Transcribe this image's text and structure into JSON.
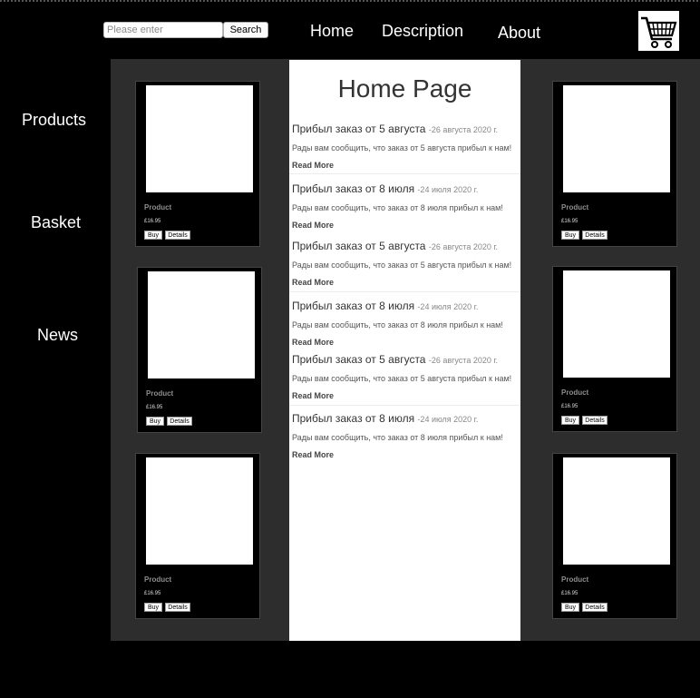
{
  "search": {
    "placeholder": "Please enter",
    "value": "",
    "button_label": "Search"
  },
  "nav": {
    "home": "Home",
    "description": "Description",
    "about": "About"
  },
  "sidebar": {
    "products": "Products",
    "basket": "Basket",
    "news": "News"
  },
  "main": {
    "title": "Home Page",
    "news": [
      {
        "heading": "Прибыл заказ от 5 августа",
        "date": "-26 августа 2020 г.",
        "text": "Рады вам сообщить, что заказ от 5 августа прибыл к нам!",
        "more": "Read More"
      },
      {
        "heading": "Прибыл заказ от 8 июля",
        "date": "-24 июля 2020 г.",
        "text": "Рады вам сообщить, что заказ от 8 июля прибыл к нам!",
        "more": "Read More"
      },
      {
        "heading": "Прибыл заказ от 5 августа",
        "date": "-26 августа 2020 г.",
        "text": "Рады вам сообщить, что заказ от 5 августа прибыл к нам!",
        "more": "Read More"
      },
      {
        "heading": "Прибыл заказ от 8 июля",
        "date": "-24 июля 2020 г.",
        "text": "Рады вам сообщить, что заказ от 8 июля прибыл к нам!",
        "more": "Read More"
      },
      {
        "heading": "Прибыл заказ от 5 августа",
        "date": "-26 августа 2020 г.",
        "text": "Рады вам сообщить, что заказ от 5 августа прибыл к нам!",
        "more": "Read More"
      },
      {
        "heading": "Прибыл заказ от 8 июля",
        "date": "-24 июля 2020 г.",
        "text": "Рады вам сообщить, что заказ от 8 июля прибыл к нам!",
        "more": "Read More"
      }
    ]
  },
  "products": [
    {
      "name": "Product",
      "price": "£16.95",
      "buy_label": "Buy",
      "details_label": "Details"
    },
    {
      "name": "Product",
      "price": "£16.95",
      "buy_label": "Buy",
      "details_label": "Details"
    },
    {
      "name": "Product",
      "price": "£16.95",
      "buy_label": "Buy",
      "details_label": "Details"
    },
    {
      "name": "Product",
      "price": "£16.95",
      "buy_label": "Buy",
      "details_label": "Details"
    },
    {
      "name": "Product",
      "price": "£16.95",
      "buy_label": "Buy",
      "details_label": "Details"
    },
    {
      "name": "Product",
      "price": "£16.95",
      "buy_label": "Buy",
      "details_label": "Details"
    }
  ],
  "icons": {
    "cart": "shopping-cart-icon"
  },
  "colors": {
    "background": "#000000",
    "panel": "#2d2d2d",
    "center": "#ffffff",
    "product_name": "#8d8d8d"
  }
}
